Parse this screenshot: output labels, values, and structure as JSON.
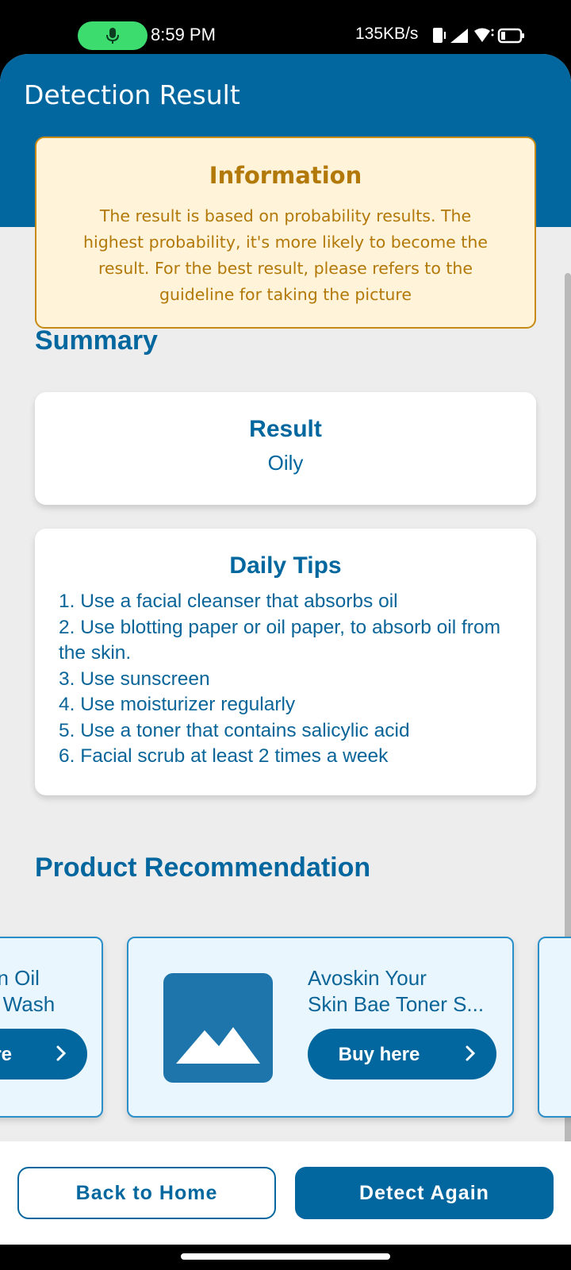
{
  "status_bar": {
    "time": "8:59 PM",
    "network_speed": "135KB/s",
    "icons": [
      "microphone-icon",
      "vibrate-icon",
      "signal-icon",
      "wifi-icon",
      "battery-icon"
    ],
    "pill_color": "#3ddc6e"
  },
  "app_bar": {
    "title": "Detection Result",
    "color": "#02679e"
  },
  "info_card": {
    "title": "Information",
    "text": "The result is based on probability results. The highest probability, it's more likely to become the result. For the best result, please refers to the guideline for taking the picture",
    "background": "#fff3d9",
    "accent": "#b27808"
  },
  "summary": {
    "heading": "Summary",
    "result_title": "Result",
    "result_value": "Oily"
  },
  "daily_tips": {
    "title": "Daily Tips",
    "items": [
      "1. Use a facial cleanser that absorbs oil",
      "2. Use blotting paper or oil paper, to absorb oil from the skin.",
      "3. Use sunscreen",
      "4. Use moisturizer regularly",
      "5. Use a toner that contains salicylic acid",
      "6. Facial scrub at least 2 times a week"
    ]
  },
  "products": {
    "heading": "Product Recommendation",
    "items": [
      {
        "name_line1": "en Oil",
        "name_line2": "e Wash",
        "button": "ere"
      },
      {
        "name_line1": "Avoskin Your",
        "name_line2": "Skin Bae Toner S...",
        "button": "Buy here",
        "image_icon": "image-placeholder-icon"
      }
    ]
  },
  "actions": {
    "back_home": "Back to Home",
    "detect_again": "Detect Again"
  }
}
